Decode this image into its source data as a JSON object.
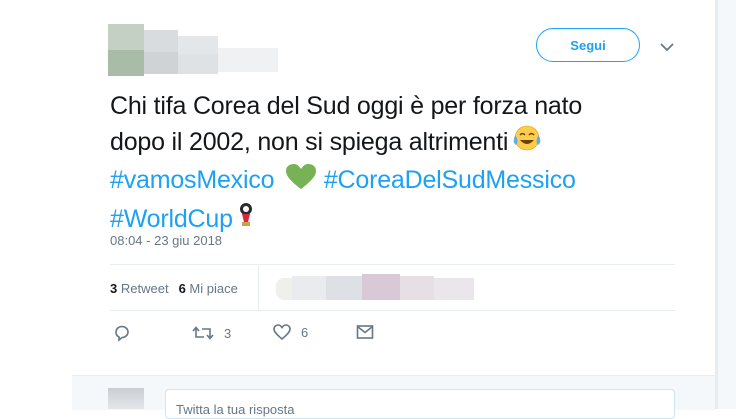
{
  "header": {
    "follow_label": "Segui",
    "chevron_icon": "chevron-down-icon"
  },
  "tweet": {
    "line1": "Chi tifa Corea del Sud oggi è per forza nato",
    "line2": "dopo il 2002, non si spiega altrimenti",
    "line2_emoji": "face-with-tears-of-joy-icon",
    "hashtag1": "#vamosMexico",
    "hashtag1_emoji": "green-heart-icon",
    "hashtag2": "#CoreaDelSudMessico",
    "hashtag3": "#WorldCup",
    "hashtag3_emoji": "world-cup-trophy-icon",
    "timestamp": "08:04 - 23 giu 2018"
  },
  "stats": {
    "retweet_count": "3",
    "retweet_label": "Retweet",
    "like_count": "6",
    "like_label": "Mi piace"
  },
  "actions": {
    "reply_icon": "reply-icon",
    "retweet_icon": "retweet-icon",
    "retweet_count": "3",
    "like_icon": "heart-icon",
    "like_count": "6",
    "dm_icon": "envelope-icon"
  },
  "reply": {
    "placeholder": "Twitta la tua risposta"
  },
  "colors": {
    "accent": "#1da1f2",
    "text": "#14171a",
    "muted": "#657786",
    "border": "#e6ecf0"
  }
}
